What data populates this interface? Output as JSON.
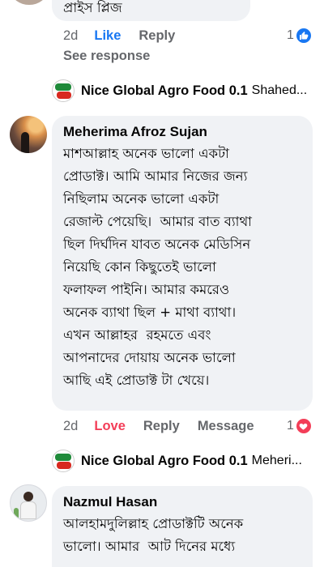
{
  "top_comment": {
    "text_tail": "প্রাইস প্লিজ",
    "time": "2d",
    "like_label": "Like",
    "reply_label": "Reply",
    "reaction_count": "1",
    "reaction_type": "like",
    "see_response": "See response"
  },
  "reply_preview_1": {
    "page_name": "Nice Global Agro Food 0.1",
    "target": "Shahed..."
  },
  "comment_1": {
    "author": "Meherima Afroz Sujan",
    "lines": [
      "মাশআল্লাহ অনেক ভালো একটা",
      "প্রোডাক্ট। আমি আমার নিজের জন্য",
      "নিছিলাম অনেক ভালো একটা",
      "রেজাল্ট পেয়েছি।  আমার বাত ব্যাথা",
      "ছিল দির্ঘদিন যাবত অনেক মেডিসিন",
      "নিয়েছি কোন কিছুতেই ভালো",
      "ফলাফল পাইনি। আমার কমরেও",
      "অনেক ব্যাথা ছিল + মাথা ব্যাথা।",
      "এখন আল্লাহর  রহমতে এবং",
      "আপনাদের দোয়ায় অনেক ভালো",
      "আছি এই প্রোডাক্ট টা খেয়ে।"
    ],
    "time": "2d",
    "love_label": "Love",
    "reply_label": "Reply",
    "message_label": "Message",
    "reaction_count": "1",
    "reaction_type": "love"
  },
  "reply_preview_2": {
    "page_name": "Nice Global Agro Food 0.1",
    "target": "Meheri..."
  },
  "comment_2": {
    "author": "Nazmul Hasan",
    "lines": [
      "আলহামদুলিল্লাহ প্রোডাক্টটি অনেক",
      "ভালো। আমার  আট দিনের মধ্যে"
    ]
  },
  "colors": {
    "bubble": "#f0f2f5",
    "like_blue": "#1877f2",
    "love_red": "#f33e58",
    "secondary_text": "#65676b"
  }
}
